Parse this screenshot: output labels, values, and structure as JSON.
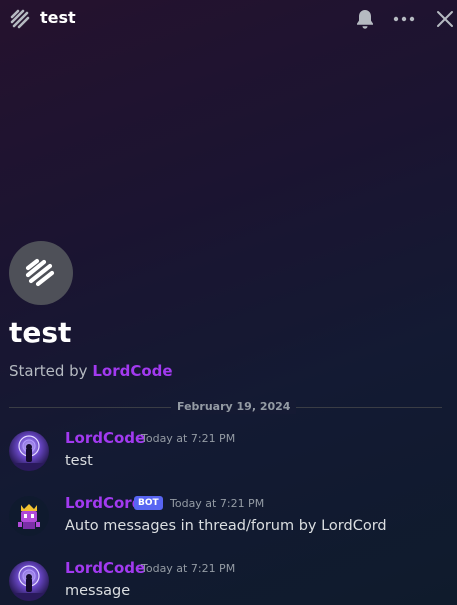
{
  "header": {
    "title": "test",
    "thread_icon": "thread-icon",
    "bell_icon": "bell-icon",
    "more_icon": "more-icon",
    "close_icon": "close-icon"
  },
  "intro": {
    "title": "test",
    "started_by_label": "Started by",
    "started_by_user": "LordCode"
  },
  "divider": {
    "date": "February 19, 2024"
  },
  "messages": [
    {
      "author": "LordCode",
      "timestamp": "Today at 7:21 PM",
      "text": "test",
      "avatar": "avatar-lordcode"
    },
    {
      "author": "LordCord",
      "bot_label": "BOT",
      "timestamp": "Today at 7:21 PM",
      "text": "Auto messages in thread/forum by LordCord",
      "avatar": "avatar-lordcord"
    },
    {
      "author": "LordCode",
      "timestamp": "Today at 7:21 PM",
      "text": "message",
      "avatar": "avatar-lordcode"
    }
  ],
  "colors": {
    "author": "#a23af0",
    "bot_tag": "#5865f2"
  }
}
